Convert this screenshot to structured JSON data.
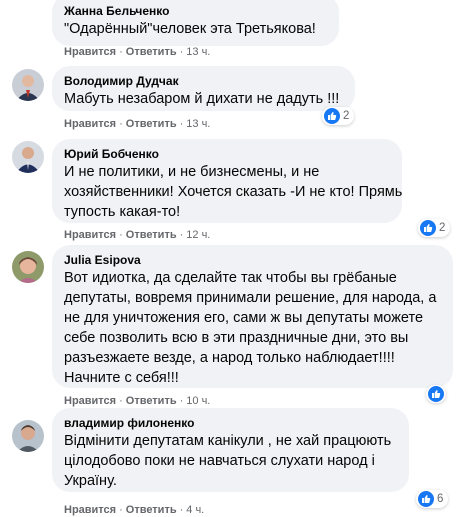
{
  "comments": [
    {
      "author": "Жанна Бельченко",
      "lines": [
        "\"Одарённый\"человек эта Третьякова!"
      ],
      "like": "Нравится",
      "reply": "Ответить",
      "time": "13 ч.",
      "reactions": ""
    },
    {
      "author": "Володимир Дудчак",
      "lines": [
        "Мабуть незабаром й дихати не дадуть !!!"
      ],
      "like": "Нравится",
      "reply": "Ответить",
      "time": "13 ч.",
      "reactions": "2"
    },
    {
      "author": "Юрий Бобченко",
      "lines": [
        "И не политики, и не бизнесмены, и не",
        "хозяйственники! Хочется сказать -И не кто! Прямь",
        "тупость какая-то!"
      ],
      "like": "Нравится",
      "reply": "Ответить",
      "time": "12 ч.",
      "reactions": "2"
    },
    {
      "author": "Julia Esipova",
      "lines": [
        "Вот идиотка, да сделайте так чтобы вы грёбаные",
        "депутаты, вовремя принимали решение, для народа, а",
        "не для уничтожения его, сами ж вы депутаты можете",
        "себе позволить всю в эти праздничные дни, это вы",
        "разъезжаете везде, а народ только наблюдает!!!!",
        "Начните с себя!!!"
      ],
      "like": "Нравится",
      "reply": "Ответить",
      "time": "10 ч.",
      "reactions": ""
    },
    {
      "author": "владимир филоненко",
      "lines": [
        "Відмінити депутатам канікули , не хай працюють",
        "цілодобово поки не навчаться слухати народ і",
        "Україну."
      ],
      "like": "Нравится",
      "reply": "Ответить",
      "time": "4 ч.",
      "reactions": "6"
    }
  ],
  "colors": {
    "bubble": "#f0f2f5",
    "like_blue": "#1877f2",
    "meta": "#65676b"
  },
  "icons": {
    "reaction": "like-thumb-icon"
  }
}
